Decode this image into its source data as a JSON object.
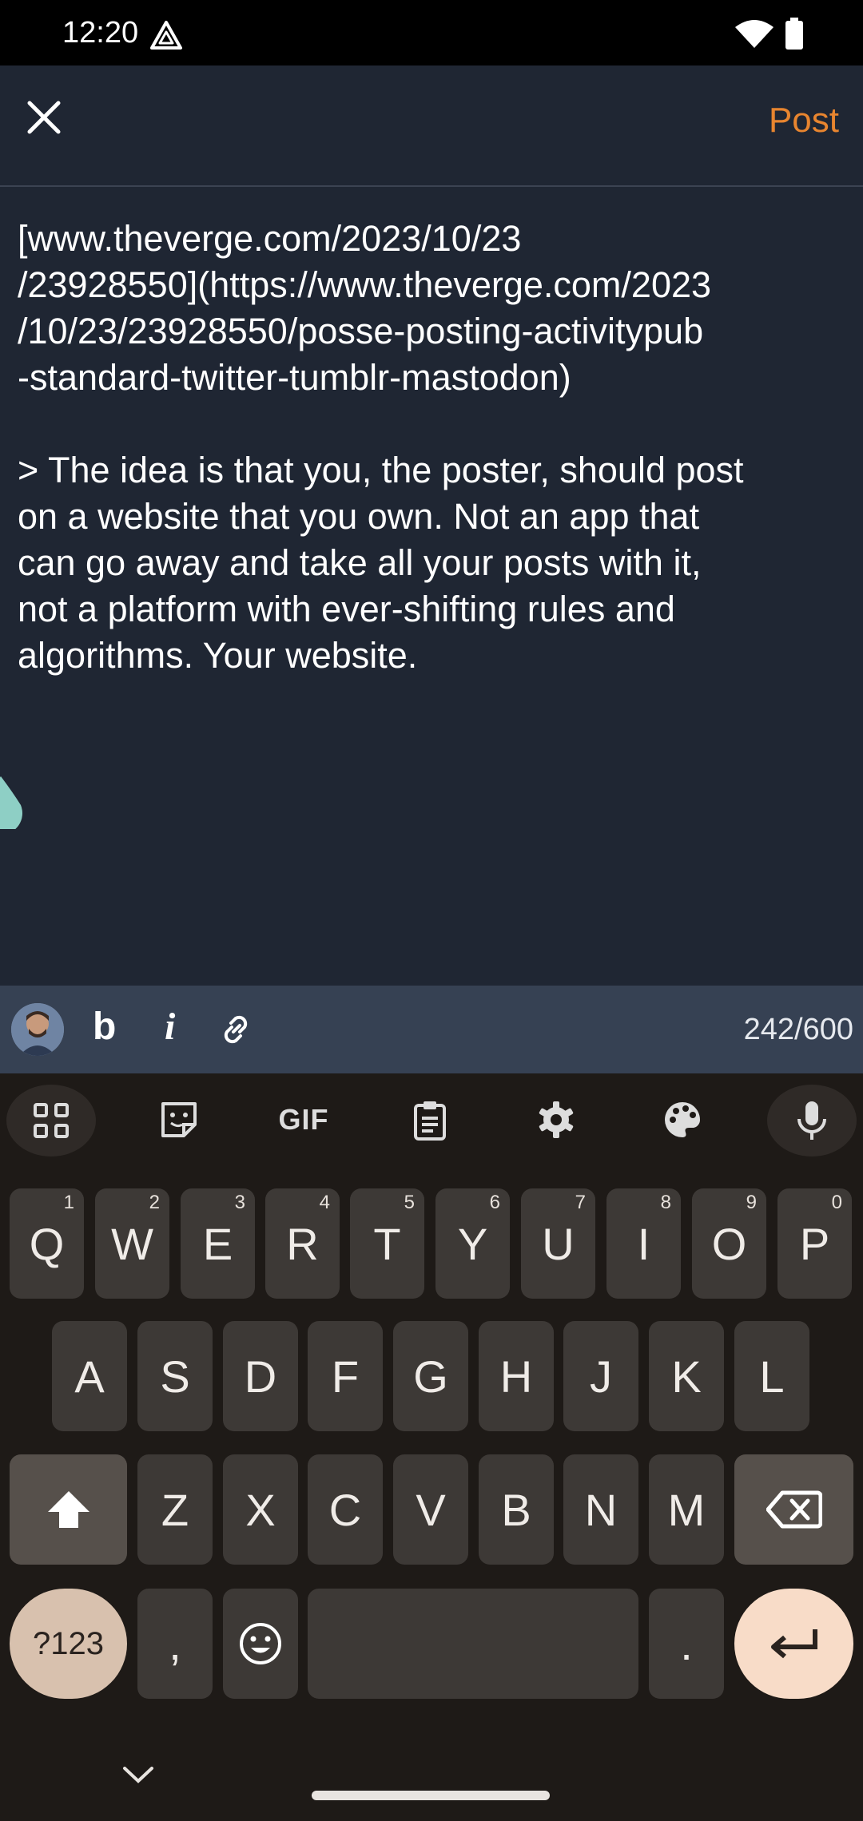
{
  "status_bar": {
    "time": "12:20"
  },
  "app_bar": {
    "post_label": "Post"
  },
  "editor": {
    "text": "[www.theverge.com/2023/10/23\n/23928550](https://www.theverge.com/2023\n/10/23/23928550/posse-posting-activitypub\n-standard-twitter-tumblr-mastodon)\n\n> The idea is that you, the poster, should post\non a website that you own. Not an app that\ncan go away and take all your posts with it,\nnot a platform with ever-shifting rules and\nalgorithms. Your website."
  },
  "format_bar": {
    "bold_label": "b",
    "italic_label": "i",
    "char_count": "242/600"
  },
  "keyboard": {
    "toolbar_icons": [
      "apps-grid-icon",
      "sticker-icon",
      "gif-icon",
      "clipboard-icon",
      "settings-icon",
      "palette-icon",
      "microphone-icon"
    ],
    "gif_label": "GIF",
    "row1": [
      {
        "key": "Q",
        "hint": "1"
      },
      {
        "key": "W",
        "hint": "2"
      },
      {
        "key": "E",
        "hint": "3"
      },
      {
        "key": "R",
        "hint": "4"
      },
      {
        "key": "T",
        "hint": "5"
      },
      {
        "key": "Y",
        "hint": "6"
      },
      {
        "key": "U",
        "hint": "7"
      },
      {
        "key": "I",
        "hint": "8"
      },
      {
        "key": "O",
        "hint": "9"
      },
      {
        "key": "P",
        "hint": "0"
      }
    ],
    "row2": [
      "A",
      "S",
      "D",
      "F",
      "G",
      "H",
      "J",
      "K",
      "L"
    ],
    "row3": [
      "Z",
      "X",
      "C",
      "V",
      "B",
      "N",
      "M"
    ],
    "symbols_label": "?123",
    "comma_label": ",",
    "period_label": ".",
    "colors": {
      "accent": "#e8852f",
      "key": "#3d3936",
      "enter": "#f8dcc8",
      "symbols": "#d8c1ae"
    }
  }
}
